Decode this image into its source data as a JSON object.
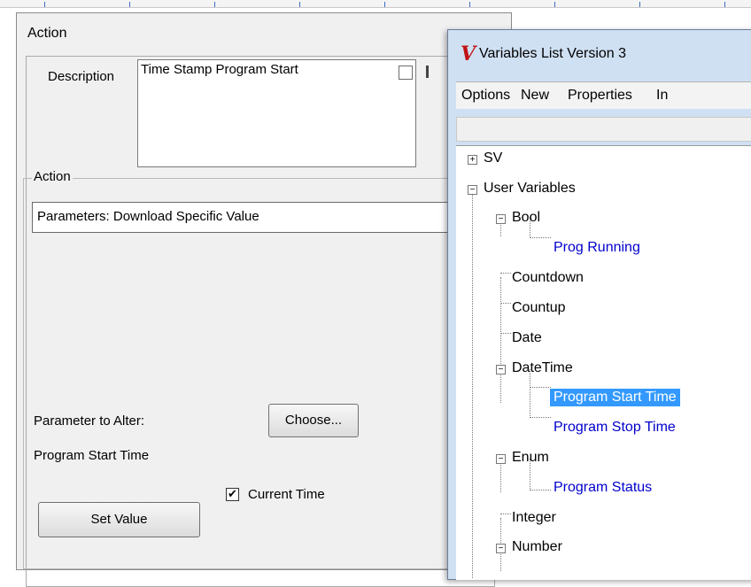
{
  "action_dialog": {
    "title": "Action",
    "description_label": "Description",
    "description_value": "Time Stamp Program Start",
    "group_label": "Action",
    "parameters_text": "Parameters: Download Specific Value",
    "parameter_to_alter_label": "Parameter to Alter:",
    "choose_button": "Choose...",
    "parameter_value": "Program Start Time",
    "current_time_label": "Current Time",
    "current_time_checked": true,
    "set_value_button": "Set Value"
  },
  "variables_window": {
    "title": "Variables List Version 3",
    "logo": "V",
    "menu": [
      "Options",
      "New",
      "Properties",
      "In"
    ],
    "tree": [
      {
        "label": "SV",
        "expanded": false
      },
      {
        "label": "User Variables",
        "expanded": true
      },
      {
        "label": "Bool",
        "expanded": true
      },
      {
        "label": "Prog Running",
        "link": true
      },
      {
        "label": "Countdown"
      },
      {
        "label": "Countup"
      },
      {
        "label": "Date"
      },
      {
        "label": "DateTime",
        "expanded": true
      },
      {
        "label": "Program Start Time",
        "selected": true
      },
      {
        "label": "Program Stop Time",
        "link": true
      },
      {
        "label": "Enum",
        "expanded": true
      },
      {
        "label": "Program Status",
        "link": true
      },
      {
        "label": "Integer"
      },
      {
        "label": "Number",
        "expanded": true
      }
    ]
  },
  "colors": {
    "selection": "#3399ff",
    "link_text": "#0000cc",
    "logo": "#c01212"
  }
}
